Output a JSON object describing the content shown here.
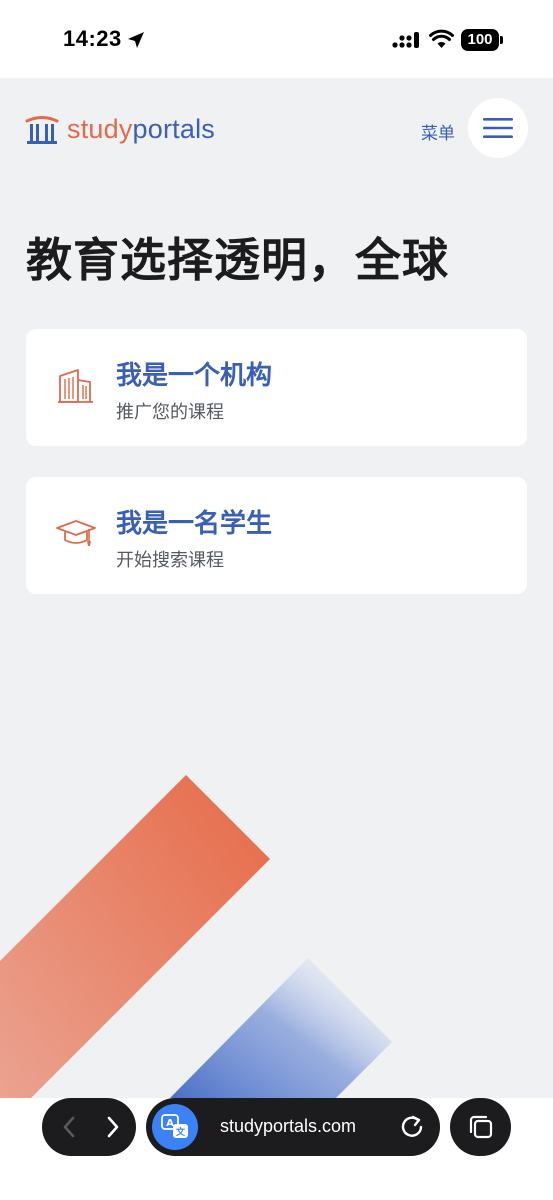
{
  "status_bar": {
    "time": "14:23",
    "battery": "100"
  },
  "site": {
    "logo_study": "study",
    "logo_portals": "portals",
    "menu_label": "菜单"
  },
  "main": {
    "headline": "教育选择透明，全球",
    "cards": [
      {
        "title": "我是一个机构",
        "subtitle": "推广您的课程",
        "icon": "building-icon"
      },
      {
        "title": "我是一名学生",
        "subtitle": "开始搜索课程",
        "icon": "graduation-cap-icon"
      }
    ]
  },
  "browser": {
    "url": "studyportals.com"
  },
  "colors": {
    "brand_orange": "#e06a4a",
    "brand_blue": "#3a5fb8",
    "page_bg": "#f0f1f3"
  }
}
